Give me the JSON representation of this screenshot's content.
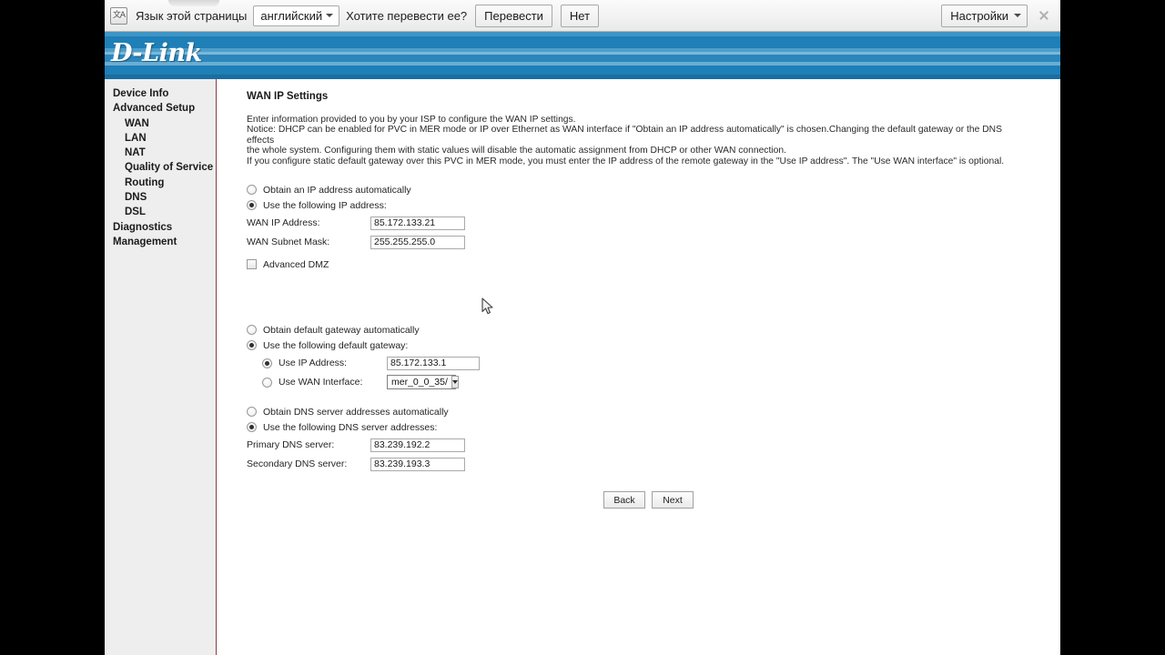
{
  "translate_bar": {
    "icon": "translate-icon",
    "icon_glyph": "文A",
    "prompt": "Язык этой страницы",
    "language_value": "английский",
    "question": "Хотите перевести ее?",
    "translate_label": "Перевести",
    "no_label": "Нет",
    "settings_label": "Настройки",
    "close_icon": "close-icon"
  },
  "banner": {
    "logo_text": "D-Link",
    "color": "#1b7cb4"
  },
  "sidebar": {
    "items": [
      {
        "label": "Device Info",
        "level": 0
      },
      {
        "label": "Advanced Setup",
        "level": 0
      },
      {
        "label": "WAN",
        "level": 1
      },
      {
        "label": "LAN",
        "level": 1
      },
      {
        "label": "NAT",
        "level": 1
      },
      {
        "label": "Quality of Service",
        "level": 1
      },
      {
        "label": "Routing",
        "level": 1
      },
      {
        "label": "DNS",
        "level": 1
      },
      {
        "label": "DSL",
        "level": 1
      },
      {
        "label": "Diagnostics",
        "level": 0
      },
      {
        "label": "Management",
        "level": 0
      }
    ]
  },
  "main": {
    "title": "WAN IP Settings",
    "description_line1": "Enter information provided to you by your ISP to configure the WAN IP settings.",
    "description_line2": "Notice: DHCP can be enabled for PVC in MER mode or IP over Ethernet as WAN interface if \"Obtain an IP address automatically\" is chosen.Changing the default gateway or the DNS effects",
    "description_line3": "the whole system. Configuring them with static values will disable the automatic assignment from DHCP or other WAN connection.",
    "description_line4": "If you configure static default gateway over this PVC in MER mode, you must enter the IP address of the remote gateway in the \"Use IP address\". The \"Use WAN interface\" is optional.",
    "ip_section": {
      "option_auto": "Obtain an IP address automatically",
      "option_static": "Use the following IP address:",
      "selected": "static",
      "wan_ip_label": "WAN IP Address:",
      "wan_ip_value": "85.172.133.21",
      "wan_mask_label": "WAN Subnet Mask:",
      "wan_mask_value": "255.255.255.0",
      "advanced_dmz_label": "Advanced DMZ",
      "advanced_dmz_checked": false
    },
    "gateway_section": {
      "option_auto": "Obtain default gateway automatically",
      "option_static": "Use the following default gateway:",
      "selected": "static",
      "use_ip_label": "Use IP Address:",
      "use_ip_value": "85.172.133.1",
      "use_ip_selected": true,
      "use_wan_label": "Use WAN Interface:",
      "use_wan_value": "mer_0_0_35/",
      "use_wan_selected": false
    },
    "dns_section": {
      "option_auto": "Obtain DNS server addresses automatically",
      "option_static": "Use the following DNS server addresses:",
      "selected": "static",
      "primary_label": "Primary DNS server:",
      "primary_value": "83.239.192.2",
      "secondary_label": "Secondary DNS server:",
      "secondary_value": "83.239.193.3"
    },
    "buttons": {
      "back": "Back",
      "next": "Next"
    }
  }
}
